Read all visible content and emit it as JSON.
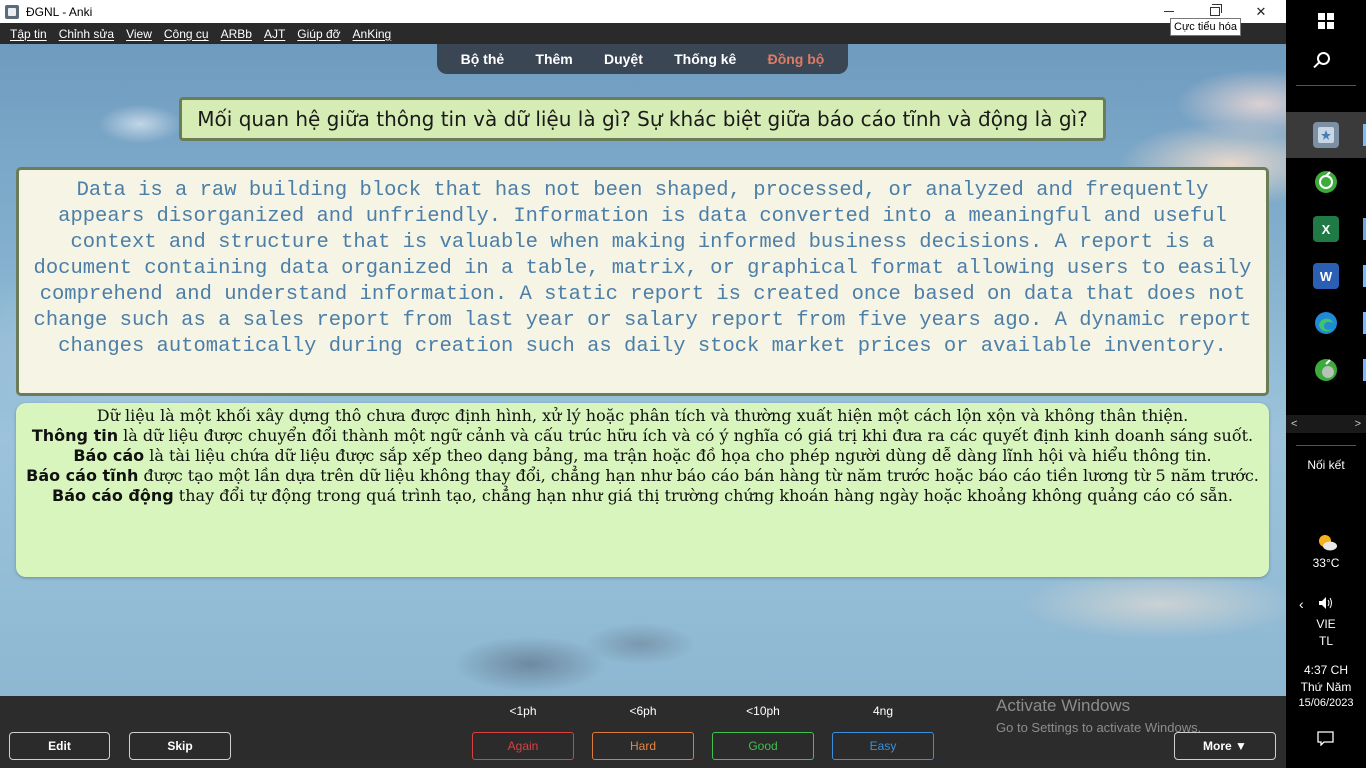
{
  "window": {
    "title": "ĐGNL - Anki",
    "tooltip": "Cực tiểu hóa",
    "close_glyph": "✕"
  },
  "menu": [
    "Tập tin",
    "Chỉnh sửa",
    "View",
    "Công cụ",
    "ARBb",
    "AJT",
    "Giúp đỡ",
    "AnKing"
  ],
  "topnav": {
    "decks": "Bộ thẻ",
    "add": "Thêm",
    "browse": "Duyệt",
    "stats": "Thống kê",
    "sync": "Đồng bộ"
  },
  "card": {
    "question": "Mối quan hệ giữa thông tin và dữ liệu là gì? Sự khác biệt giữa báo cáo tĩnh và động là gì?",
    "answer_en": "Data is a raw building block that has not been shaped, processed, or analyzed and frequently appears disorganized and unfriendly. Information is data converted into a meaningful and useful context and structure that is valuable when making informed business decisions. A report is a document containing data organized in a table, matrix, or graphical format allowing users to easily comprehend and understand information. A static report is created once based on data that does not change such as a sales report from last year or salary report from five years ago. A dynamic report changes automatically during creation such as daily stock market prices or available inventory.",
    "answer_vi": {
      "p1": "Dữ liệu là một khối xây dựng thô chưa được định hình, xử lý hoặc phân tích và thường xuất hiện một cách lộn xộn và không thân thiện.",
      "p2_term": "Thông tin",
      "p2_rest": " là dữ liệu được chuyển đổi thành một ngữ cảnh và cấu trúc hữu ích và có ý nghĩa có giá trị khi đưa ra các quyết định kinh doanh sáng suốt.",
      "p3_term": "Báo cáo",
      "p3_rest": " là tài liệu chứa dữ liệu được sắp xếp theo dạng bảng, ma trận hoặc đồ họa cho phép người dùng dễ dàng lĩnh hội và hiểu thông tin.",
      "p4_term": "Báo cáo tĩnh",
      "p4_rest": " được tạo một lần dựa trên dữ liệu không thay đổi, chẳng hạn như báo cáo bán hàng từ năm trước hoặc báo cáo tiền lương từ 5 năm trước.",
      "p5_term": "Báo cáo động",
      "p5_rest": " thay đổi tự động trong quá trình tạo, chẳng hạn như giá thị trường chứng khoán hàng ngày hoặc khoảng không quảng cáo có sẵn."
    }
  },
  "bottom": {
    "edit": "Edit",
    "skip": "Skip",
    "more": "More ▼",
    "intervals": [
      "<1ph",
      "<6ph",
      "<10ph",
      "4ng"
    ],
    "again": "Again",
    "hard": "Hard",
    "good": "Good",
    "easy": "Easy",
    "activate_title": "Activate Windows",
    "activate_sub": "Go to Settings to activate Windows."
  },
  "taskbar": {
    "network": "Nối kết",
    "temperature": "33°C",
    "language": "VIE",
    "ime": "TL",
    "time": "4:37 CH",
    "weekday": "Thứ Năm",
    "date": "15/06/2023",
    "scroll_left": "<",
    "scroll_right": ">"
  },
  "colors": {
    "again": "#d94040",
    "hard": "#e8853f",
    "good": "#3ec24b",
    "easy": "#3a8fe0",
    "sync": "#e07a64"
  }
}
